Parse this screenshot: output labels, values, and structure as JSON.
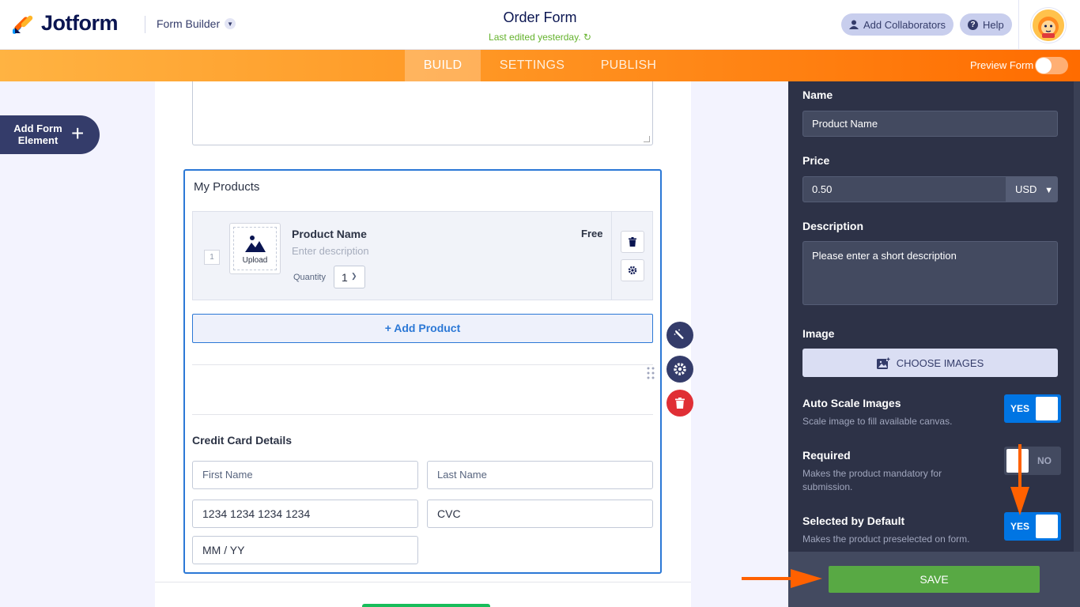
{
  "header": {
    "logo_text": "Jotform",
    "builder_menu": "Form Builder",
    "form_title": "Order Form",
    "last_edited": "Last edited yesterday.",
    "add_collaborators": "Add Collaborators",
    "help": "Help"
  },
  "nav": {
    "tabs": [
      {
        "label": "BUILD",
        "active": true
      },
      {
        "label": "SETTINGS",
        "active": false
      },
      {
        "label": "PUBLISH",
        "active": false
      }
    ],
    "preview_label": "Preview Form",
    "preview_on": false
  },
  "left": {
    "add_element_label": "Add Form Element"
  },
  "form": {
    "products_heading": "My Products",
    "product": {
      "index": "1",
      "upload_label": "Upload",
      "name": "Product Name",
      "description_placeholder": "Enter description",
      "price_text": "Free",
      "quantity_label": "Quantity",
      "quantity_value": "1"
    },
    "add_product_label": "+ Add Product",
    "credit_card_heading": "Credit Card Details",
    "first_name_placeholder": "First Name",
    "last_name_placeholder": "Last Name",
    "card_number_placeholder": "1234 1234 1234 1234",
    "cvc_placeholder": "CVC",
    "expiry_placeholder": "MM / YY"
  },
  "panel": {
    "name_label": "Name",
    "name_value": "Product Name",
    "price_label": "Price",
    "price_value": "0.50",
    "currency": "USD",
    "description_label": "Description",
    "description_placeholder": "Please enter a short description",
    "image_label": "Image",
    "choose_images": "CHOOSE IMAGES",
    "auto_scale_label": "Auto Scale Images",
    "auto_scale_sub": "Scale image to fill available canvas.",
    "auto_scale_state": "YES",
    "required_label": "Required",
    "required_sub": "Makes the product mandatory for submission.",
    "required_state": "NO",
    "selected_default_label": "Selected by Default",
    "selected_default_sub": "Makes the product preselected on form.",
    "selected_default_state": "YES",
    "save_label": "SAVE"
  },
  "colors": {
    "accent_blue": "#2b78d6",
    "nav_orange": "#ff6c00",
    "panel_bg": "#2d3247",
    "save_green": "#58a944",
    "toggle_on": "#0075e3",
    "annotation_arrow": "#ff6100"
  }
}
